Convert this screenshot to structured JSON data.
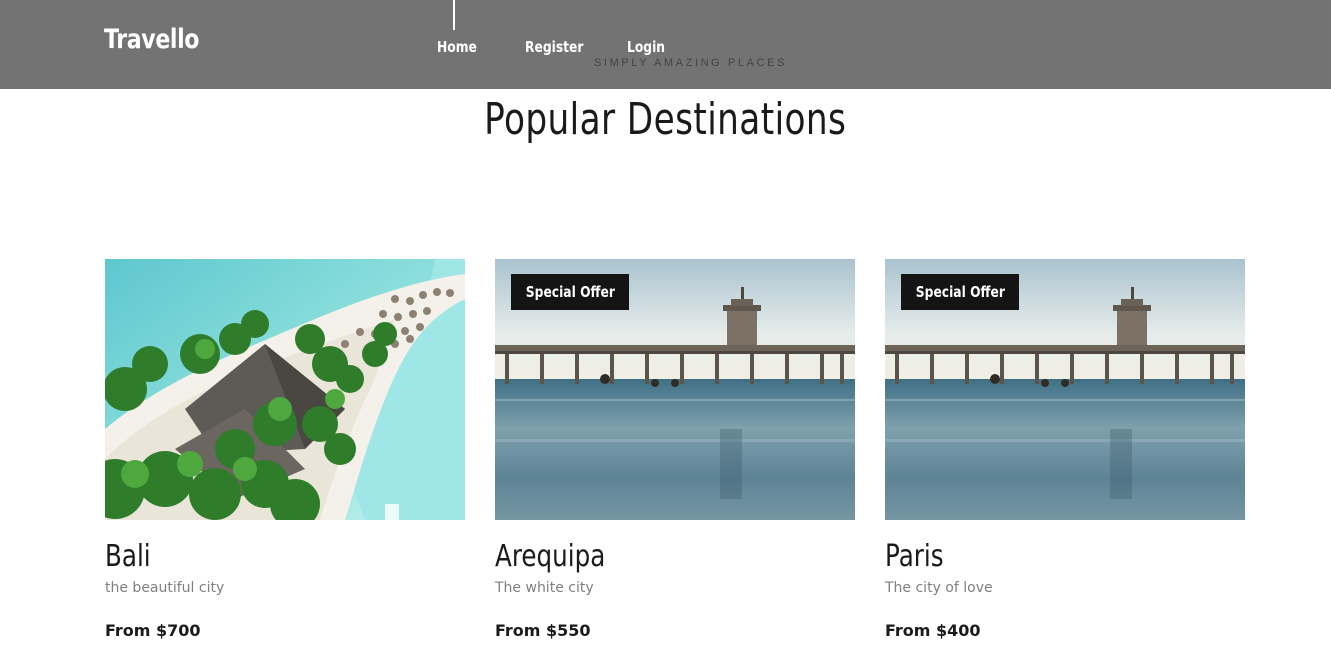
{
  "header": {
    "logo": "Travello",
    "nav": [
      {
        "label": "Home"
      },
      {
        "label": "Register"
      },
      {
        "label": "Login"
      }
    ],
    "tagline": "SIMPLY AMAZING PLACES",
    "background_color": "#737373"
  },
  "section": {
    "title": "Popular Destinations"
  },
  "destinations": [
    {
      "name": "Bali",
      "subtitle": "the beautiful city",
      "price": "From $700",
      "image": "tropical-island-beach-photo",
      "badge": ""
    },
    {
      "name": "Arequipa",
      "subtitle": "The white city",
      "price": "From $550",
      "image": "pier-ocean-photo",
      "badge": "Special Offer"
    },
    {
      "name": "Paris",
      "subtitle": "The city of love",
      "price": "From $400",
      "image": "pier-ocean-photo",
      "badge": "Special Offer"
    }
  ],
  "colors": {
    "badge_bg": "#141414",
    "text_dark": "#1a1a1a",
    "text_muted": "#808080"
  }
}
